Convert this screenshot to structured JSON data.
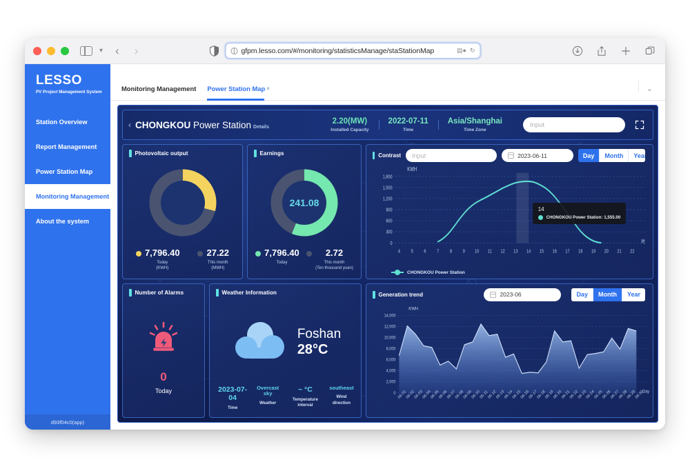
{
  "browser": {
    "url": "gfpm.lesso.com/#/monitoring/statisticsManage/staStationMap",
    "back_label": "‹",
    "forward_label": "›",
    "icons": [
      "sidebar-icon",
      "chevron-down-icon",
      "back-icon",
      "forward-icon",
      "shield-icon",
      "globe-icon",
      "reader-icon",
      "reload-icon",
      "download-icon",
      "share-icon",
      "new-tab-icon",
      "tab-overview-icon"
    ]
  },
  "sidebar": {
    "logo": "LESSO",
    "subtitle": "PV Project Management System",
    "items": [
      {
        "label": "Station Overview",
        "active": false
      },
      {
        "label": "Report Management",
        "active": false
      },
      {
        "label": "Power Station Map",
        "active": false
      },
      {
        "label": "Monitoring Management",
        "active": true
      },
      {
        "label": "About the system",
        "active": false
      }
    ],
    "footer": "d93f04c0(app)"
  },
  "tabs": {
    "items": [
      {
        "label": "Monitoring Management",
        "active": false,
        "closable": false
      },
      {
        "label": "Power Station Map",
        "active": true,
        "closable": true
      }
    ],
    "close_glyph": "×",
    "chevron": "⌄"
  },
  "station_bar": {
    "back_chevron": "‹",
    "name_bold": "CHONGKOU",
    "name_rest": " Power Station",
    "details": "Details",
    "metrics": [
      {
        "value": "2.20(MW)",
        "label": "Installed Capacity"
      },
      {
        "value": "2022-07-11",
        "label": "Time"
      },
      {
        "value": "Asia/Shanghai",
        "label": "Time Zone"
      }
    ],
    "search_placeholder": "Input",
    "expand_icon": "fullscreen-icon"
  },
  "pv_card": {
    "title": "Photovoltaic output",
    "accent": "#F4D35E",
    "track": "#4a5470",
    "percent": 29,
    "stats": [
      {
        "value": "7,796.40",
        "caption": "Today\n(KWH)",
        "color": "#F4D35E"
      },
      {
        "value": "27.22",
        "caption": "This month\n(MWH)",
        "color": "#4a5470"
      }
    ]
  },
  "earnings_card": {
    "title": "Earnings",
    "accent": "#74E8AE",
    "track": "#4a5470",
    "percent": 56,
    "center_value": "241.08",
    "stats": [
      {
        "value": "7,796.40",
        "caption": "Today",
        "color": "#74E8AE"
      },
      {
        "value": "2.72",
        "caption": "This month\n(Ten thousand yuan)",
        "color": "#4a5470"
      }
    ]
  },
  "contrast_card": {
    "title": "Contrast",
    "search_placeholder": "Input",
    "date_value": "2023-06-11",
    "segments": [
      {
        "label": "Day",
        "active": true
      },
      {
        "label": "Month",
        "active": false
      },
      {
        "label": "Year",
        "active": false
      }
    ],
    "legend": "CHONGKOU Power Station",
    "tooltip": {
      "header": "14",
      "series": "CHONGKOU Power Station: 1,555.00"
    }
  },
  "alarm_card": {
    "title": "Number of Alarms",
    "icon": "alarm-light-icon",
    "count": "0",
    "caption": "Today",
    "color": "#ef5a7a"
  },
  "weather_card": {
    "title": "Weather Information",
    "icon": "cloud-icon",
    "city": "Foshan",
    "temperature": "28°C",
    "fields": [
      {
        "value": "2023-07-04",
        "label": "Time",
        "small": false
      },
      {
        "value": "Overcast sky",
        "label": "Weather",
        "small": true
      },
      {
        "value": "~ °C",
        "label": "Temperature interval",
        "small": false
      },
      {
        "value": "southeast",
        "label": "Wind direction",
        "small": true
      }
    ]
  },
  "generation_card": {
    "title": "Generation trend",
    "date_value": "2023-06",
    "segments": [
      {
        "label": "Day",
        "active": false
      },
      {
        "label": "Month",
        "active": true
      },
      {
        "label": "Year",
        "active": false
      }
    ]
  },
  "chart_data": [
    {
      "id": "contrast",
      "type": "line",
      "title": "Contrast",
      "ylabel": "KWH",
      "xlabel": "时",
      "ylim": [
        0,
        1800
      ],
      "yticks": [
        0,
        300,
        600,
        900,
        1200,
        1500,
        1800
      ],
      "ytick_labels": [
        "0",
        "300",
        "600",
        "900",
        "1,200",
        "1,500",
        "1,800"
      ],
      "x": [
        4,
        5,
        6,
        7,
        8,
        9,
        10,
        11,
        12,
        13,
        14,
        15,
        16,
        17,
        18,
        19,
        20,
        21,
        22
      ],
      "xtick_labels": [
        "4",
        "5",
        "6",
        "7",
        "8",
        "9",
        "10",
        "11",
        "12",
        "13",
        "14",
        "15",
        "16",
        "17",
        "18",
        "19",
        "20",
        "21",
        "22"
      ],
      "grid": true,
      "legend_position": "bottom-left",
      "series": [
        {
          "name": "CHONGKOU Power Station",
          "color": "#5FE0D2",
          "values": [
            null,
            null,
            null,
            40,
            330,
            700,
            950,
            1130,
            1340,
            1480,
            1555,
            1500,
            1330,
            1010,
            600,
            260,
            40,
            null,
            null
          ]
        }
      ],
      "highlight": {
        "x": 14,
        "value": 1555
      }
    },
    {
      "id": "generation",
      "type": "area",
      "title": "Generation trend",
      "ylabel": "KWH",
      "xlabel": "Day",
      "ylim": [
        0,
        14000
      ],
      "yticks": [
        0,
        2000,
        4000,
        6000,
        8000,
        10000,
        12000,
        14000
      ],
      "ytick_labels": [
        "0",
        "2,000",
        "4,000",
        "6,000",
        "8,000",
        "10,000",
        "12,000",
        "14,000"
      ],
      "grid": true,
      "categories": [
        "06-01",
        "06-02",
        "06-03",
        "06-04",
        "06-05",
        "06-06",
        "06-07",
        "06-08",
        "06-09",
        "06-10",
        "06-11",
        "06-12",
        "06-13",
        "06-14",
        "06-15",
        "06-16",
        "06-17",
        "06-18",
        "06-19",
        "06-20",
        "06-21",
        "06-22",
        "06-23",
        "06-24",
        "06-25",
        "06-26",
        "06-27",
        "06-28",
        "06-29",
        "06-30"
      ],
      "series": [
        {
          "name": "Generation",
          "color": "#8FB8F0",
          "values": [
            6700,
            12050,
            10600,
            8500,
            8200,
            5000,
            5700,
            4300,
            8700,
            9200,
            12400,
            10300,
            10600,
            6400,
            7000,
            3500,
            3700,
            3600,
            5600,
            11200,
            9200,
            9400,
            4400,
            6900,
            7100,
            7400,
            9900,
            7900,
            11600,
            11200
          ]
        }
      ]
    }
  ]
}
